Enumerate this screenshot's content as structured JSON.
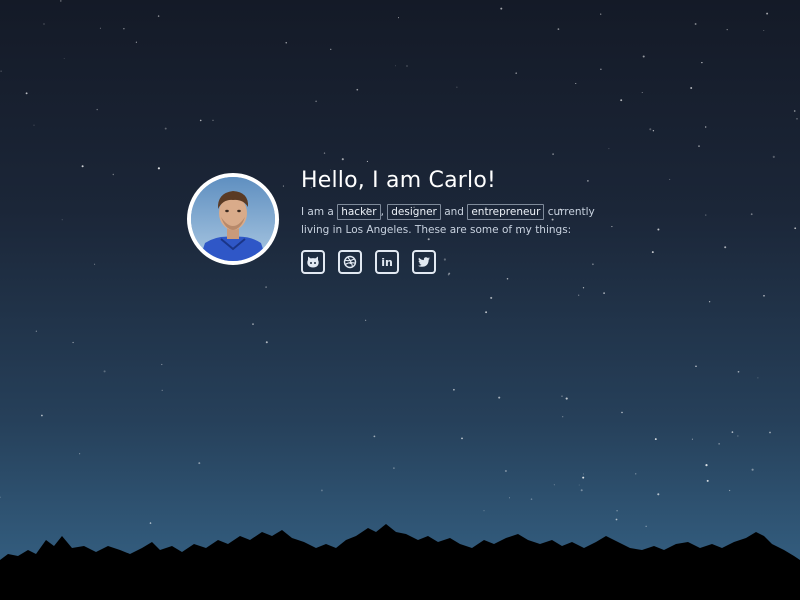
{
  "profile": {
    "title": "Hello, I am Carlo!",
    "bio": {
      "intro": "I am a",
      "tags": [
        "hacker",
        "designer",
        "entrepreneur"
      ],
      "sep1": ",",
      "sep2": "and",
      "rest": "currently living in Los Angeles. These are some of my things:"
    },
    "avatar_alt": "avatar"
  },
  "socials": [
    {
      "name": "github",
      "icon": "github-icon"
    },
    {
      "name": "dribbble",
      "icon": "dribbble-icon"
    },
    {
      "name": "linkedin",
      "icon": "linkedin-icon",
      "glyph": "in"
    },
    {
      "name": "twitter",
      "icon": "twitter-icon"
    }
  ],
  "colors": {
    "sky_top": "#141a27",
    "sky_bottom": "#36607f",
    "ground": "#000000",
    "text": "#ffffff",
    "icon_border": "#e2e9f2"
  }
}
